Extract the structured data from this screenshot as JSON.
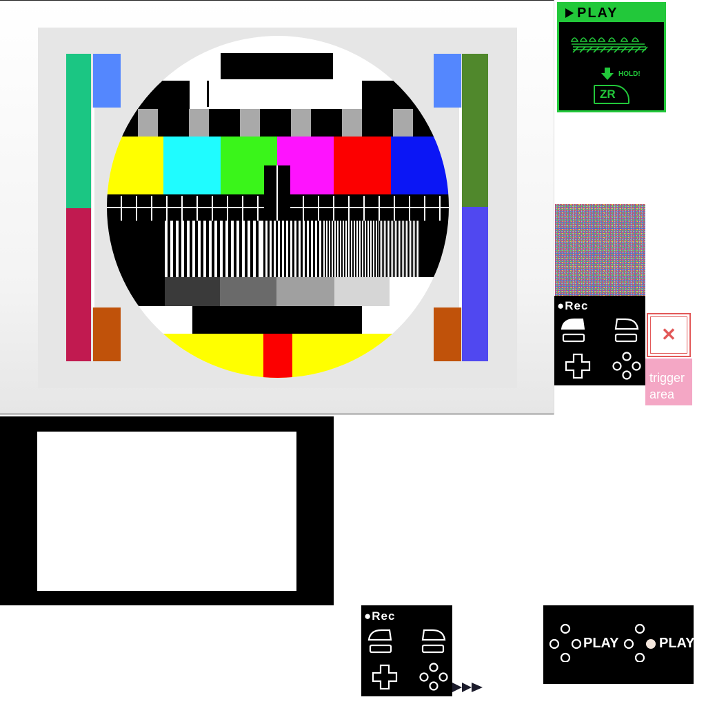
{
  "play_card": {
    "title": "PLAY",
    "hold_label": "HOLD!",
    "button_label": "ZR",
    "accent_color": "#22c83a"
  },
  "recorder_panels": [
    {
      "rec_label": "●Rec"
    },
    {
      "rec_label": "●Rec"
    }
  ],
  "close_button": {
    "icon": "close-icon",
    "glyph": "✕",
    "color": "#e25858"
  },
  "trigger_area": {
    "label": "trigger area"
  },
  "play_buttons": [
    {
      "label": "PLAY"
    },
    {
      "label": "PLAY"
    }
  ],
  "test_pattern": {
    "color_bars": [
      "#ffff00",
      "#1ffcff",
      "#3af51a",
      "#fe13fe",
      "#fc0000",
      "#0b16f5"
    ],
    "gray_steps": [
      "#3a3a3a",
      "#6a6a6a",
      "#a0a0a0",
      "#d6d6d6"
    ],
    "side_colors": {
      "left_top": "#1bc683",
      "left_bottom": "#c11a50",
      "right_top": "#50882c",
      "right_bottom": "#5048f0",
      "corner_blue": "#5487fe",
      "corner_orange": "#c0520a"
    }
  }
}
